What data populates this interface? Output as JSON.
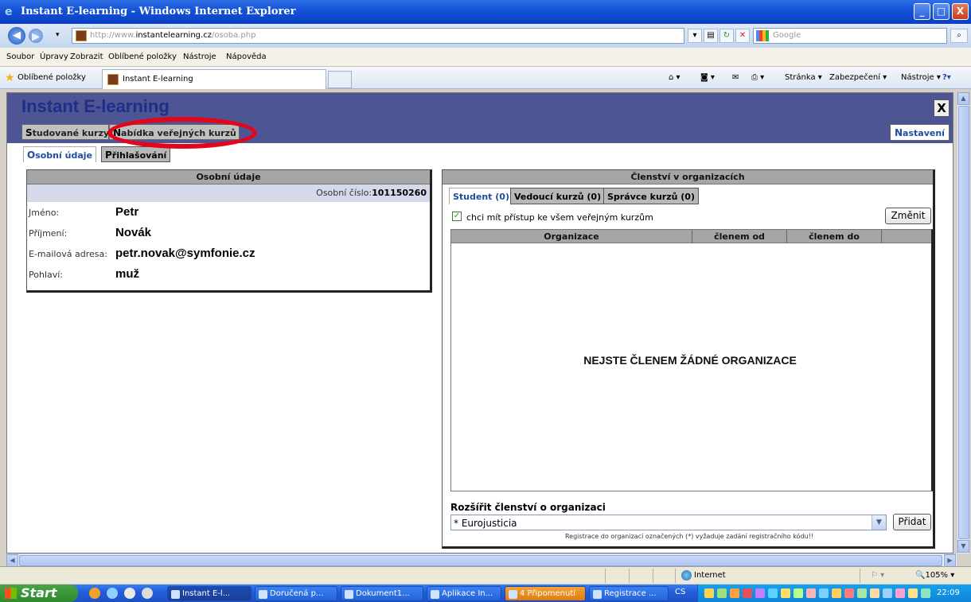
{
  "window": {
    "title": "Instant E-learning - Windows Internet Explorer",
    "min_label": "_",
    "max_label": "□",
    "close_label": "X"
  },
  "browser": {
    "back_label": "◀",
    "forward_label": "▶",
    "url_prefix": "http://www.",
    "url_domain": "instantelearning.cz",
    "url_path": "/osoba.php",
    "search_placeholder": "Google",
    "search_button": "⌕",
    "menu": [
      "Soubor",
      "Úpravy",
      "Zobrazit",
      "Oblíbené položky",
      "Nástroje",
      "Nápověda"
    ],
    "favorites_label": "Oblíbené položky",
    "tab_title": "Instant E-learning",
    "commands": [
      "Stránka ▾",
      "Zabezpečení ▾",
      "Nástroje ▾"
    ],
    "help_label": "?▾"
  },
  "app": {
    "title": "Instant E-learning",
    "close_label": "X",
    "main_tabs": [
      {
        "cap": "S",
        "rest": "tudované kurzy"
      },
      {
        "cap": "N",
        "rest": "abídka veřejných kurzů"
      }
    ],
    "settings": {
      "cap": "N",
      "rest": "astavení"
    },
    "sub_tabs": [
      {
        "cap": "O",
        "rest": "sobní údaje"
      },
      {
        "cap": "P",
        "rest": "řihlašování"
      }
    ]
  },
  "personal": {
    "header": "Osobní údaje",
    "number_label": "Osobní číslo:",
    "number_value": "101150260",
    "fields": [
      {
        "label": "Jméno:",
        "value": "Petr"
      },
      {
        "label": "Příjmení:",
        "value": "Novák"
      },
      {
        "label": "E-mailová adresa:",
        "value": "petr.novak@symfonie.cz"
      },
      {
        "label": "Pohlaví:",
        "value": "muž"
      }
    ]
  },
  "membership": {
    "header": "Členství v organizacích",
    "tabs": [
      "Student (0)",
      "Vedoucí kurzů (0)",
      "Správce kurzů (0)"
    ],
    "checkbox_label": "chci mít přístup ke všem veřejným kurzům",
    "checkbox_checked": true,
    "change_button": "Změnit",
    "columns": [
      "Organizace",
      "členem od",
      "členem do"
    ],
    "empty_message": "NEJSTE ČLENEM ŽÁDNÉ ORGANIZACE",
    "extend_label": "Rozšířit členství o organizaci",
    "select_value": "* Eurojusticia",
    "add_button": "Přidat",
    "note": "Registrace do organizací označených (*) vyžaduje zadání registračního kódu!!"
  },
  "statusbar": {
    "zone": "Internet",
    "zoom": "🔍105%  ▾"
  },
  "taskbar": {
    "start_label": "Start",
    "tasks": [
      "Instant E-l...",
      "Doručená p...",
      "Dokument1...",
      "Aplikace In...",
      "4 Připomenutí",
      "Registrace ..."
    ],
    "language": "CS",
    "clock": "22:09"
  }
}
